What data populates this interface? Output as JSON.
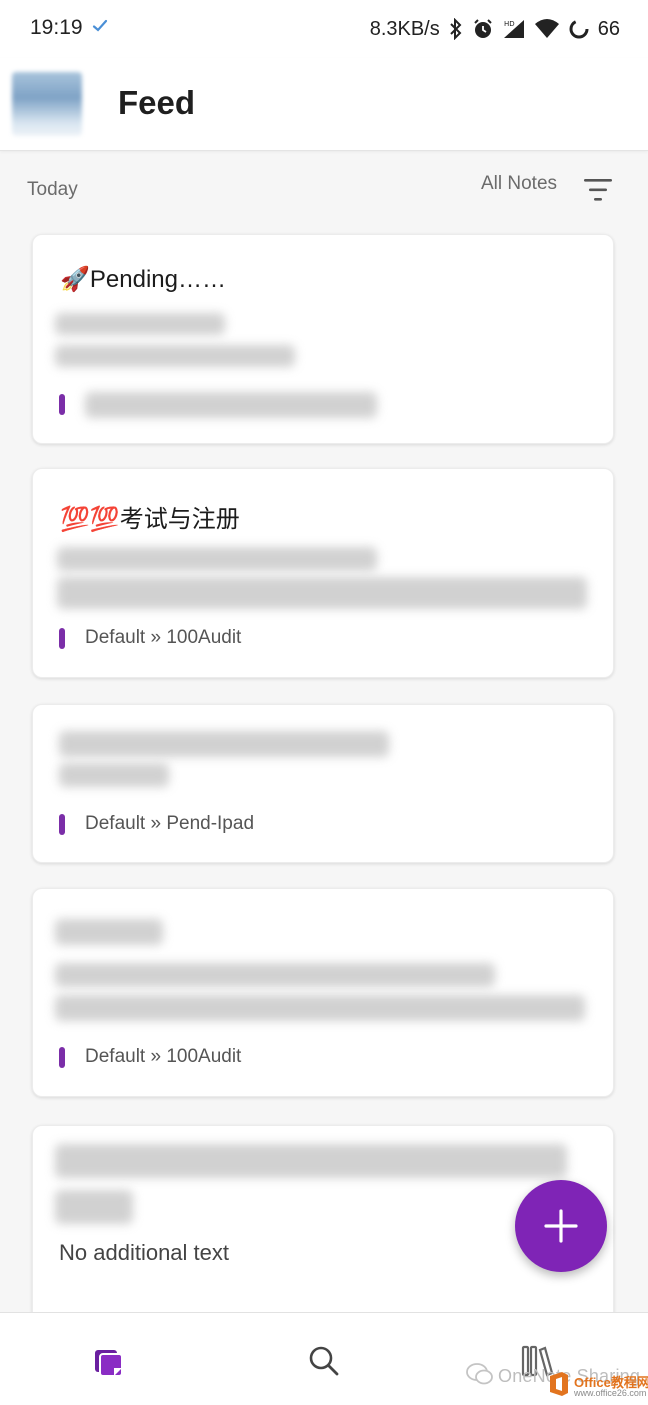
{
  "status_bar": {
    "time": "19:19",
    "net_speed": "8.3KB/s",
    "battery": "66"
  },
  "header": {
    "title": "Feed"
  },
  "feed": {
    "section_label": "Today",
    "filter_label": "All Notes"
  },
  "cards": [
    {
      "emoji": "🚀",
      "title": "Pending……",
      "tag": ""
    },
    {
      "emoji": "💯💯",
      "title": "考试与注册",
      "tag": ""
    },
    {
      "tag": "Default » 100Audit"
    },
    {
      "tag": "Default » Pend-Ipad"
    },
    {
      "tag": "Default » 100Audit"
    },
    {
      "empty_text": "No additional text"
    }
  ],
  "bottom_nav": {
    "items": [
      "notes-icon",
      "search-icon",
      "notebooks-icon"
    ],
    "watermark": "OneNote Sharing",
    "site_name": "Office教程网",
    "site_url": "www.office26.com"
  },
  "colors": {
    "accent": "#7f24b6",
    "tag_bar": "#7b2ea8"
  }
}
